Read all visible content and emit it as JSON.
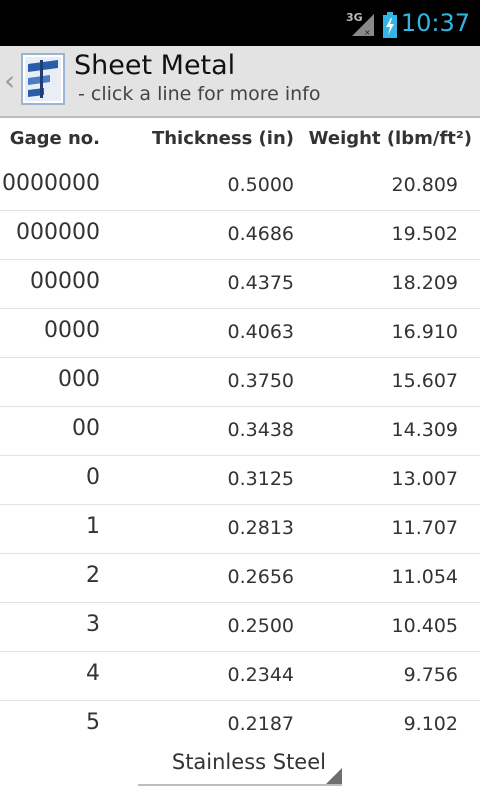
{
  "status_bar": {
    "network": "3G",
    "time": "10:37",
    "accent_color": "#33b5e5",
    "icons": [
      "signal-icon",
      "battery-charging-icon"
    ]
  },
  "action_bar": {
    "title": "Sheet Metal",
    "subtitle": " - click a line for more info",
    "back_icon": "chevron-left-icon",
    "app_icon": "sheet-metal-app-icon"
  },
  "table": {
    "headers": [
      "Gage no.",
      "Thickness (in)",
      "Weight (lbm/ft²)"
    ],
    "rows": [
      {
        "gage": "0000000",
        "thickness": "0.5000",
        "weight": "20.809"
      },
      {
        "gage": "000000",
        "thickness": "0.4686",
        "weight": "19.502"
      },
      {
        "gage": "00000",
        "thickness": "0.4375",
        "weight": "18.209"
      },
      {
        "gage": "0000",
        "thickness": "0.4063",
        "weight": "16.910"
      },
      {
        "gage": "000",
        "thickness": "0.3750",
        "weight": "15.607"
      },
      {
        "gage": "00",
        "thickness": "0.3438",
        "weight": "14.309"
      },
      {
        "gage": "0",
        "thickness": "0.3125",
        "weight": "13.007"
      },
      {
        "gage": "1",
        "thickness": "0.2813",
        "weight": "11.707"
      },
      {
        "gage": "2",
        "thickness": "0.2656",
        "weight": "11.054"
      },
      {
        "gage": "3",
        "thickness": "0.2500",
        "weight": "10.405"
      },
      {
        "gage": "4",
        "thickness": "0.2344",
        "weight": "9.756"
      },
      {
        "gage": "5",
        "thickness": "0.2187",
        "weight": "9.102"
      }
    ]
  },
  "material_spinner": {
    "selected": "Stainless Steel"
  }
}
